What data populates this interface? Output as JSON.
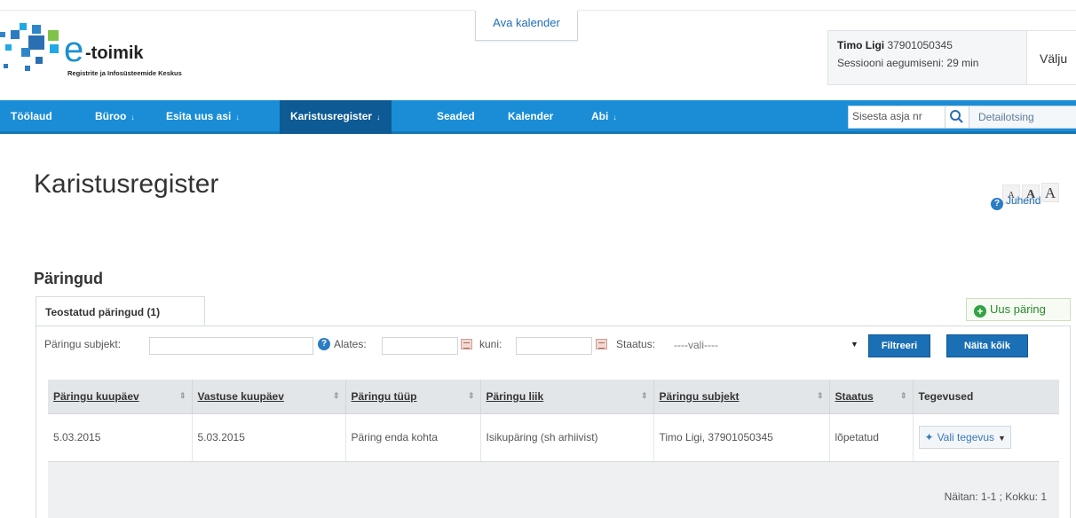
{
  "header": {
    "logo": {
      "brand": "e-toimik",
      "subtitle": "Registrite ja Infosüsteemide Keskus"
    },
    "calendar_button": "Ava kalender",
    "user": {
      "name": "Timo Ligi",
      "id_code": "37901050345",
      "session_text": "Sessiooni aegumiseni: 29 min"
    },
    "logout_button": "Välju"
  },
  "nav": {
    "items": [
      {
        "label": "Töölaud",
        "has_dropdown": false,
        "active": false
      },
      {
        "label": "Büroo",
        "has_dropdown": true,
        "active": false
      },
      {
        "label": "Esita uus asi",
        "has_dropdown": true,
        "active": false
      },
      {
        "label": "Karistusregister",
        "has_dropdown": true,
        "active": true
      },
      {
        "label": "Seaded",
        "has_dropdown": false,
        "active": false
      },
      {
        "label": "Kalender",
        "has_dropdown": false,
        "active": false
      },
      {
        "label": "Abi",
        "has_dropdown": true,
        "active": false
      }
    ],
    "search_placeholder": "Sisesta asja nr",
    "detail_search": "Detailotsing"
  },
  "page": {
    "title": "Karistusregister",
    "font_sizes": [
      "A",
      "A",
      "A"
    ],
    "help_link": "Juhend",
    "section_title": "Päringud"
  },
  "tabs": [
    {
      "label": "Teostatud päringud (1)",
      "active": true
    }
  ],
  "new_query_button": "Uus päring",
  "filters": {
    "subject_label": "Päringu subjekt:",
    "subject_value": "",
    "from_label": "Alates:",
    "to_label": "kuni:",
    "status_label": "Staatus:",
    "status_selected": "----vali----",
    "filter_button": "Filtreeri",
    "show_all_button": "Näita kõik"
  },
  "table": {
    "columns": [
      "Päringu kuupäev",
      "Vastuse kuupäev",
      "Päringu tüüp",
      "Päringu liik",
      "Päringu subjekt",
      "Staatus",
      "Tegevused"
    ],
    "rows": [
      [
        "5.03.2015",
        "5.03.2015",
        "Päring enda kohta",
        "Isikupäring (sh arhiivist)",
        "Timo Ligi, 37901050345",
        "lõpetatud"
      ]
    ],
    "action_label": "Vali tegevus",
    "pager": "Näitan: 1-1 ; Kokku: 1"
  },
  "colors": {
    "nav": "#1a8dd6",
    "nav_active": "#0d5a94",
    "button_blue": "#1b6fb4",
    "link": "#1e6fb8",
    "success": "#34a244"
  }
}
